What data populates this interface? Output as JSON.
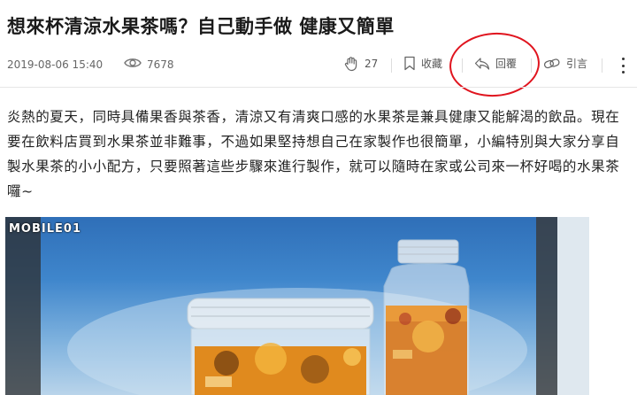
{
  "article": {
    "title": "想來杯清涼水果茶嗎？自己動手做 健康又簡單",
    "date": "2019-08-06 15:40",
    "views": "7678"
  },
  "actions": {
    "like_count": "27",
    "bookmark_label": "收藏",
    "reply_label": "回覆",
    "quote_label": "引言"
  },
  "body": {
    "paragraph": "炎熱的夏天，同時具備果香與茶香，清涼又有清爽口感的水果茶是兼具健康又能解渴的飲品。現在要在飲料店買到水果茶並非難事，不過如果堅持想自己在家製作也很簡單，小編特別與大家分享自製水果茶的小小配方，只要照著這些步驟來進行製作，就可以隨時在家或公司來一杯好喝的水果茶囉~"
  },
  "photo": {
    "watermark": "MOBILE01"
  },
  "icons": {
    "views": "eye-icon",
    "like": "clap-hand-icon",
    "bookmark": "bookmark-icon",
    "reply": "reply-arrow-icon",
    "quote": "quote-link-icon",
    "more": "vertical-dots-icon"
  },
  "colors": {
    "highlight_circle": "#e0141e",
    "sky": "#3f86cc",
    "tea_amber": "#d9781e"
  }
}
